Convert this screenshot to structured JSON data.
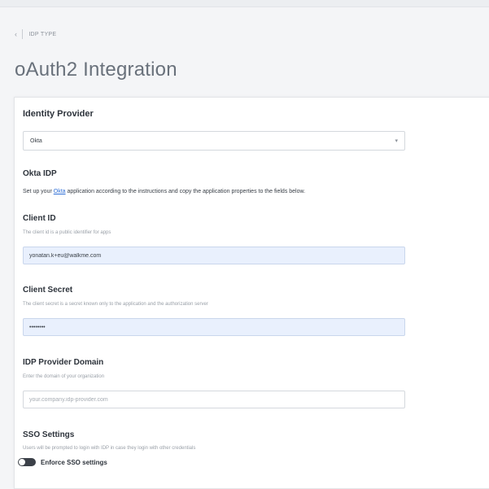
{
  "breadcrumb": {
    "back_icon": "chevron-left-icon",
    "label": "IDP TYPE"
  },
  "page": {
    "title": "oAuth2 Integration"
  },
  "identity_provider": {
    "title": "Identity Provider",
    "selected": "Okta",
    "caret_icon": "chevron-down-icon"
  },
  "okta_idp": {
    "title": "Okta IDP",
    "desc_before": "Set up your ",
    "link": "Okta",
    "desc_after": " application according to the instructions and copy the application properties to the fields below."
  },
  "client_id": {
    "title": "Client ID",
    "help": "The client id is a public identifier for apps",
    "value": "yonatan.k+eu@walkme.com"
  },
  "client_secret": {
    "title": "Client Secret",
    "help": "The client secret is a secret known only to the application and the authorization server",
    "value": "••••••••"
  },
  "idp_domain": {
    "title": "IDP Provider Domain",
    "help": "Enter the domain of your organization",
    "placeholder": "your.company.idp-provider.com"
  },
  "sso": {
    "title": "SSO Settings",
    "help": "Users will be prompted to login with IDP in case they login with other credentials",
    "toggle_label": "Enforce SSO settings",
    "enforced": false
  },
  "colors": {
    "link": "#2f6fd6",
    "filled_field": "#e9f0fd",
    "toggle_track": "#3b4048"
  }
}
